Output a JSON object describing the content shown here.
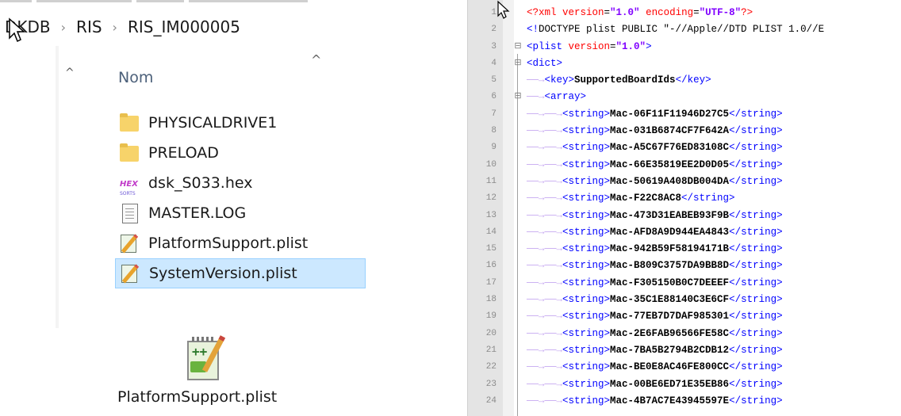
{
  "breadcrumb": [
    "DKDB",
    "RIS",
    "RIS_IM000005"
  ],
  "separator": "›",
  "column_header": "Nom",
  "files": [
    {
      "name": "PHYSICALDRIVE1",
      "icon": "folder-icon"
    },
    {
      "name": "PRELOAD",
      "icon": "folder-icon"
    },
    {
      "name": "dsk_S033.hex",
      "icon": "hex-file-icon",
      "icon_text": "HEX",
      "icon_subtext": "SORTS"
    },
    {
      "name": "MASTER.LOG",
      "icon": "text-file-icon"
    },
    {
      "name": "PlatformSupport.plist",
      "icon": "notepad-file-icon"
    },
    {
      "name": "SystemVersion.plist",
      "icon": "notepad-file-icon",
      "selected": true
    }
  ],
  "large_icon": {
    "label": "PlatformSupport.plist",
    "icon": "notepad-plus-plus-icon",
    "icon_text": "++"
  },
  "editor": {
    "lines": [
      {
        "n": "1",
        "parts": [
          [
            "pi",
            "<?xml "
          ],
          [
            "attr",
            "version"
          ],
          [
            "dt",
            "="
          ],
          [
            "val",
            "\"1.0\""
          ],
          [
            "dt",
            " "
          ],
          [
            "attr",
            "encoding"
          ],
          [
            "dt",
            "="
          ],
          [
            "val",
            "\"UTF-8\""
          ],
          [
            "pi",
            "?>"
          ]
        ]
      },
      {
        "n": "2",
        "parts": [
          [
            "bracket",
            "<!"
          ],
          [
            "dt",
            "DOCTYPE plist PUBLIC \"-//Apple//DTD PLIST 1.0//E"
          ]
        ]
      },
      {
        "n": "3",
        "fold": "⊟",
        "parts": [
          [
            "tag",
            "<plist "
          ],
          [
            "attr",
            "version"
          ],
          [
            "dt",
            "="
          ],
          [
            "val",
            "\"1.0\""
          ],
          [
            "tag",
            ">"
          ]
        ]
      },
      {
        "n": "4",
        "fold": "⊟",
        "parts": [
          [
            "tag",
            "<dict>"
          ]
        ]
      },
      {
        "n": "5",
        "parts": [
          [
            "tab",
            "——→"
          ],
          [
            "tag",
            "<key>"
          ],
          [
            "txt",
            "SupportedBoardIds"
          ],
          [
            "tag",
            "</key>"
          ]
        ]
      },
      {
        "n": "6",
        "fold": "⊟",
        "parts": [
          [
            "tab",
            "——→"
          ],
          [
            "tag",
            "<array>"
          ]
        ]
      },
      {
        "n": "7",
        "parts": [
          [
            "tab",
            "——→——→"
          ],
          [
            "tag",
            "<string>"
          ],
          [
            "txt",
            "Mac-06F11F11946D27C5"
          ],
          [
            "tag",
            "</string>"
          ]
        ]
      },
      {
        "n": "8",
        "parts": [
          [
            "tab",
            "——→——→"
          ],
          [
            "tag",
            "<string>"
          ],
          [
            "txt",
            "Mac-031B6874CF7F642A"
          ],
          [
            "tag",
            "</string>"
          ]
        ]
      },
      {
        "n": "9",
        "parts": [
          [
            "tab",
            "——→——→"
          ],
          [
            "tag",
            "<string>"
          ],
          [
            "txt",
            "Mac-A5C67F76ED83108C"
          ],
          [
            "tag",
            "</string>"
          ]
        ]
      },
      {
        "n": "10",
        "parts": [
          [
            "tab",
            "——→——→"
          ],
          [
            "tag",
            "<string>"
          ],
          [
            "txt",
            "Mac-66E35819EE2D0D05"
          ],
          [
            "tag",
            "</string>"
          ]
        ]
      },
      {
        "n": "11",
        "parts": [
          [
            "tab",
            "——→——→"
          ],
          [
            "tag",
            "<string>"
          ],
          [
            "txt",
            "Mac-50619A408DB004DA"
          ],
          [
            "tag",
            "</string>"
          ]
        ]
      },
      {
        "n": "12",
        "parts": [
          [
            "tab",
            "——→——→"
          ],
          [
            "tag",
            "<string>"
          ],
          [
            "txt",
            "Mac-F22C8AC8"
          ],
          [
            "tag",
            "</string>"
          ]
        ]
      },
      {
        "n": "13",
        "parts": [
          [
            "tab",
            "——→——→"
          ],
          [
            "tag",
            "<string>"
          ],
          [
            "txt",
            "Mac-473D31EABEB93F9B"
          ],
          [
            "tag",
            "</string>"
          ]
        ]
      },
      {
        "n": "14",
        "parts": [
          [
            "tab",
            "——→——→"
          ],
          [
            "tag",
            "<string>"
          ],
          [
            "txt",
            "Mac-AFD8A9D944EA4843"
          ],
          [
            "tag",
            "</string>"
          ]
        ]
      },
      {
        "n": "15",
        "parts": [
          [
            "tab",
            "——→——→"
          ],
          [
            "tag",
            "<string>"
          ],
          [
            "txt",
            "Mac-942B59F58194171B"
          ],
          [
            "tag",
            "</string>"
          ]
        ]
      },
      {
        "n": "16",
        "parts": [
          [
            "tab",
            "——→——→"
          ],
          [
            "tag",
            "<string>"
          ],
          [
            "txt",
            "Mac-B809C3757DA9BB8D"
          ],
          [
            "tag",
            "</string>"
          ]
        ]
      },
      {
        "n": "17",
        "parts": [
          [
            "tab",
            "——→——→"
          ],
          [
            "tag",
            "<string>"
          ],
          [
            "txt",
            "Mac-F305150B0C7DEEEF"
          ],
          [
            "tag",
            "</string>"
          ]
        ]
      },
      {
        "n": "18",
        "parts": [
          [
            "tab",
            "——→——→"
          ],
          [
            "tag",
            "<string>"
          ],
          [
            "txt",
            "Mac-35C1E88140C3E6CF"
          ],
          [
            "tag",
            "</string>"
          ]
        ]
      },
      {
        "n": "19",
        "parts": [
          [
            "tab",
            "——→——→"
          ],
          [
            "tag",
            "<string>"
          ],
          [
            "txt",
            "Mac-77EB7D7DAF985301"
          ],
          [
            "tag",
            "</string>"
          ]
        ]
      },
      {
        "n": "20",
        "parts": [
          [
            "tab",
            "——→——→"
          ],
          [
            "tag",
            "<string>"
          ],
          [
            "txt",
            "Mac-2E6FAB96566FE58C"
          ],
          [
            "tag",
            "</string>"
          ]
        ]
      },
      {
        "n": "21",
        "parts": [
          [
            "tab",
            "——→——→"
          ],
          [
            "tag",
            "<string>"
          ],
          [
            "txt",
            "Mac-7BA5B2794B2CDB12"
          ],
          [
            "tag",
            "</string>"
          ]
        ]
      },
      {
        "n": "22",
        "parts": [
          [
            "tab",
            "——→——→"
          ],
          [
            "tag",
            "<string>"
          ],
          [
            "txt",
            "Mac-BE0E8AC46FE800CC"
          ],
          [
            "tag",
            "</string>"
          ]
        ]
      },
      {
        "n": "23",
        "parts": [
          [
            "tab",
            "——→——→"
          ],
          [
            "tag",
            "<string>"
          ],
          [
            "txt",
            "Mac-00BE6ED71E35EB86"
          ],
          [
            "tag",
            "</string>"
          ]
        ]
      },
      {
        "n": "24",
        "parts": [
          [
            "tab",
            "——→——→"
          ],
          [
            "tag",
            "<string>"
          ],
          [
            "txt",
            "Mac-4B7AC7E43945597E"
          ],
          [
            "tag",
            "</string>"
          ]
        ]
      }
    ]
  }
}
